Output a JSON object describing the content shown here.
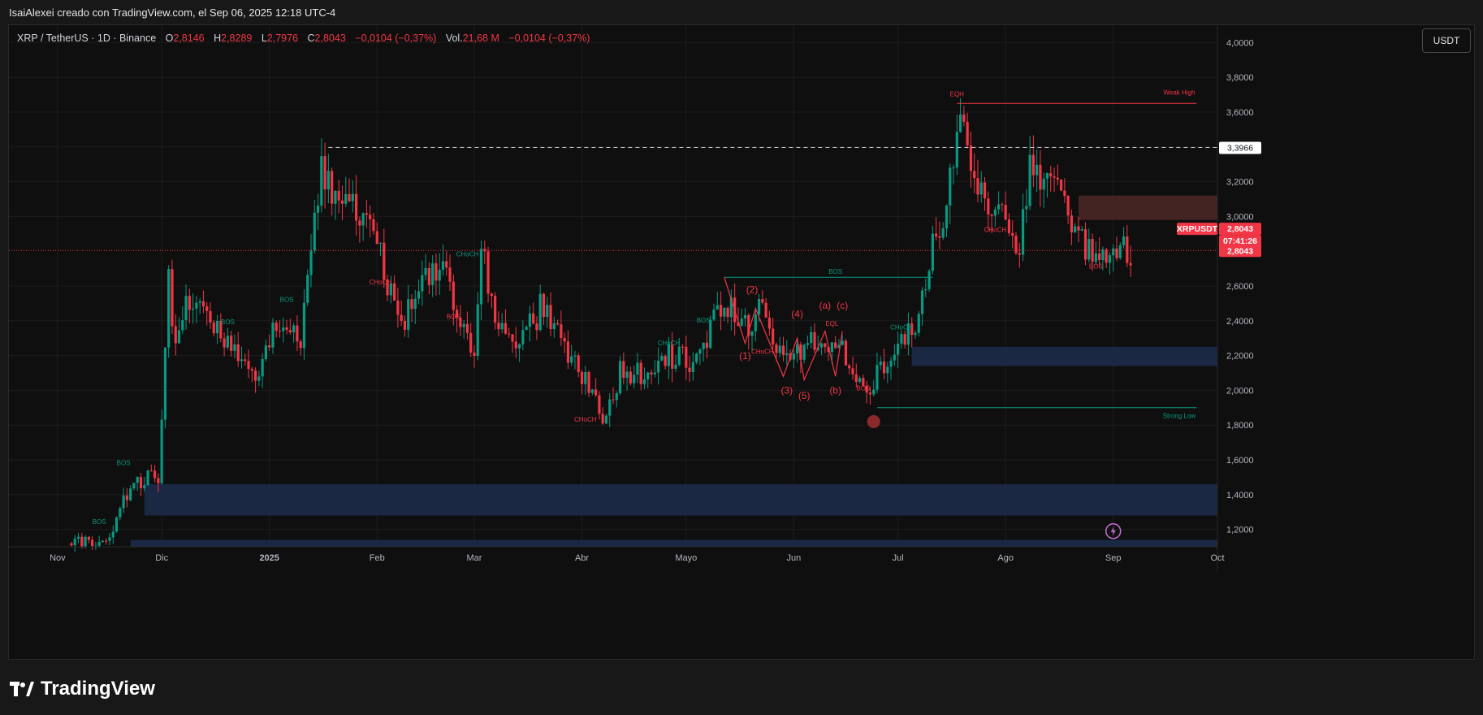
{
  "header": {
    "credit": "IsaiAlexei creado con TradingView.com, el Sep 06, 2025 12:18 UTC-4"
  },
  "legend": {
    "symbol": "XRP / TetherUS · 1D · Binance",
    "o_label": "O",
    "o": "2,8146",
    "h_label": "H",
    "h": "2,8289",
    "l_label": "L",
    "l": "2,7976",
    "c_label": "C",
    "c": "2,8043",
    "change": "−0,0104 (−0,37%)",
    "vol_label": "Vol.",
    "vol": "21,68 M",
    "vol_change": "−0,0104 (−0,37%)"
  },
  "currency_button": "USDT",
  "footer": {
    "brand": "TradingView"
  },
  "chart_data": {
    "type": "candlestick",
    "symbol": "XRPUSDT",
    "exchange": "Binance",
    "interval": "1D",
    "x_range": [
      "2024-10-18",
      "2025-10-01"
    ],
    "y_range": [
      1.1,
      4.1
    ],
    "y_ticks": [
      "4,0000",
      "3,8000",
      "3,6000",
      "3,4000",
      "3,2000",
      "3,0000",
      "2,6000",
      "2,4000",
      "2,2000",
      "2,0000",
      "1,8000",
      "1,6000",
      "1,4000",
      "1,2000"
    ],
    "y_tick_values": [
      4.0,
      3.8,
      3.6,
      3.4,
      3.2,
      3.0,
      2.6,
      2.4,
      2.2,
      2.0,
      1.8,
      1.6,
      1.4,
      1.2
    ],
    "x_ticks": [
      {
        "label": "Nov",
        "date": "2024-11-01"
      },
      {
        "label": "Dic",
        "date": "2024-12-01"
      },
      {
        "label": "2025",
        "date": "2025-01-01"
      },
      {
        "label": "Feb",
        "date": "2025-02-01"
      },
      {
        "label": "Mar",
        "date": "2025-03-01"
      },
      {
        "label": "Abr",
        "date": "2025-04-01"
      },
      {
        "label": "Mayo",
        "date": "2025-05-01"
      },
      {
        "label": "Jun",
        "date": "2025-06-01"
      },
      {
        "label": "Jul",
        "date": "2025-07-01"
      },
      {
        "label": "Ago",
        "date": "2025-08-01"
      },
      {
        "label": "Sep",
        "date": "2025-09-01"
      },
      {
        "label": "Oct",
        "date": "2025-10-01"
      }
    ],
    "grid": true,
    "colors": {
      "up": "#089981",
      "down": "#f23645",
      "zone_blue": "#1c2b4a",
      "zone_red": "#4a2626"
    },
    "price_path": [
      {
        "date": "2024-11-05",
        "close": 1.12
      },
      {
        "date": "2024-11-15",
        "close": 1.13
      },
      {
        "date": "2024-11-22",
        "close": 1.45
      },
      {
        "date": "2024-11-30",
        "close": 1.52
      },
      {
        "date": "2024-12-03",
        "close": 2.62
      },
      {
        "date": "2024-12-05",
        "close": 2.25
      },
      {
        "date": "2024-12-09",
        "close": 2.55
      },
      {
        "date": "2024-12-15",
        "close": 2.35
      },
      {
        "date": "2024-12-22",
        "close": 2.25
      },
      {
        "date": "2024-12-29",
        "close": 2.05
      },
      {
        "date": "2025-01-03",
        "close": 2.4
      },
      {
        "date": "2025-01-10",
        "close": 2.3
      },
      {
        "date": "2025-01-16",
        "close": 3.3
      },
      {
        "date": "2025-01-20",
        "close": 3.05
      },
      {
        "date": "2025-01-27",
        "close": 3.05
      },
      {
        "date": "2025-02-02",
        "close": 2.75
      },
      {
        "date": "2025-02-08",
        "close": 2.4
      },
      {
        "date": "2025-02-14",
        "close": 2.6
      },
      {
        "date": "2025-02-20",
        "close": 2.7
      },
      {
        "date": "2025-02-25",
        "close": 2.35
      },
      {
        "date": "2025-03-01",
        "close": 2.15
      },
      {
        "date": "2025-03-03",
        "close": 2.85
      },
      {
        "date": "2025-03-07",
        "close": 2.35
      },
      {
        "date": "2025-03-15",
        "close": 2.3
      },
      {
        "date": "2025-03-21",
        "close": 2.5
      },
      {
        "date": "2025-03-30",
        "close": 2.15
      },
      {
        "date": "2025-04-07",
        "close": 1.85
      },
      {
        "date": "2025-04-12",
        "close": 2.1
      },
      {
        "date": "2025-04-20",
        "close": 2.08
      },
      {
        "date": "2025-04-26",
        "close": 2.2
      },
      {
        "date": "2025-05-04",
        "close": 2.15
      },
      {
        "date": "2025-05-12",
        "close": 2.55
      },
      {
        "date": "2025-05-17",
        "close": 2.35
      },
      {
        "date": "2025-05-22",
        "close": 2.45
      },
      {
        "date": "2025-05-30",
        "close": 2.2
      },
      {
        "date": "2025-06-05",
        "close": 2.25
      },
      {
        "date": "2025-06-10",
        "close": 2.3
      },
      {
        "date": "2025-06-17",
        "close": 2.2
      },
      {
        "date": "2025-06-22",
        "close": 2.0
      },
      {
        "date": "2025-06-27",
        "close": 2.15
      },
      {
        "date": "2025-07-02",
        "close": 2.25
      },
      {
        "date": "2025-07-07",
        "close": 2.4
      },
      {
        "date": "2025-07-11",
        "close": 2.85
      },
      {
        "date": "2025-07-14",
        "close": 3.0
      },
      {
        "date": "2025-07-18",
        "close": 3.5
      },
      {
        "date": "2025-07-21",
        "close": 3.45
      },
      {
        "date": "2025-07-26",
        "close": 3.05
      },
      {
        "date": "2025-08-02",
        "close": 2.95
      },
      {
        "date": "2025-08-05",
        "close": 2.85
      },
      {
        "date": "2025-08-08",
        "close": 3.3
      },
      {
        "date": "2025-08-14",
        "close": 3.15
      },
      {
        "date": "2025-08-19",
        "close": 3.05
      },
      {
        "date": "2025-08-24",
        "close": 2.85
      },
      {
        "date": "2025-08-30",
        "close": 2.8
      },
      {
        "date": "2025-09-06",
        "close": 2.8
      }
    ],
    "hlines": [
      {
        "id": "swing-high-dashed",
        "value": 3.3966,
        "from": "2025-01-18",
        "to": "2025-10-01",
        "style": "dashed",
        "color": "#c8c8c8"
      },
      {
        "id": "weak-high",
        "value": 3.65,
        "from": "2025-07-18",
        "to": "2025-09-25",
        "style": "solid",
        "color": "#f23645"
      },
      {
        "id": "strong-low",
        "value": 1.9,
        "from": "2025-06-25",
        "to": "2025-09-25",
        "style": "solid",
        "color": "#089981"
      },
      {
        "id": "bos-jul",
        "value": 2.65,
        "from": "2025-05-12",
        "to": "2025-07-11",
        "style": "solid",
        "color": "#089981"
      },
      {
        "id": "current-price",
        "value": 2.8043,
        "from": "2024-10-18",
        "to": "2025-10-01",
        "style": "dotted",
        "color": "#f23645"
      }
    ],
    "zones": [
      {
        "id": "demand-low",
        "y1": 1.28,
        "y2": 1.46,
        "from": "2024-11-26",
        "to": "2025-10-01",
        "color": "#1c2b4a"
      },
      {
        "id": "demand-bottom",
        "y1": 1.1,
        "y2": 1.14,
        "from": "2024-11-22",
        "to": "2025-10-01",
        "color": "#1c2b4a"
      },
      {
        "id": "demand-jul",
        "y1": 2.14,
        "y2": 2.25,
        "from": "2025-07-05",
        "to": "2025-10-01",
        "color": "#1c2b4a"
      },
      {
        "id": "supply-aug",
        "y1": 2.98,
        "y2": 3.12,
        "from": "2025-08-22",
        "to": "2025-10-01",
        "color": "#4a2626"
      }
    ],
    "structure_labels": [
      {
        "text": "BOS",
        "date": "2024-11-20",
        "value": 1.57,
        "color": "#089981"
      },
      {
        "text": "BOS",
        "date": "2024-11-13",
        "value": 1.23,
        "color": "#089981"
      },
      {
        "text": "BOS",
        "date": "2024-12-20",
        "value": 2.38,
        "color": "#089981"
      },
      {
        "text": "BOS",
        "date": "2025-01-06",
        "value": 2.51,
        "color": "#089981"
      },
      {
        "text": "CHoCH",
        "date": "2025-02-02",
        "value": 2.61,
        "color": "#f23645"
      },
      {
        "text": "CHoCH",
        "date": "2025-02-27",
        "value": 2.77,
        "color": "#089981"
      },
      {
        "text": "BOS",
        "date": "2025-02-23",
        "value": 2.41,
        "color": "#f23645"
      },
      {
        "text": "CHoCH",
        "date": "2025-04-02",
        "value": 1.82,
        "color": "#f23645"
      },
      {
        "text": "CHoCH",
        "date": "2025-04-26",
        "value": 2.26,
        "color": "#089981"
      },
      {
        "text": "BOS",
        "date": "2025-05-06",
        "value": 2.39,
        "color": "#089981"
      },
      {
        "text": "BOS",
        "date": "2025-06-13",
        "value": 2.67,
        "color": "#089981"
      },
      {
        "text": "CHoCH",
        "date": "2025-05-23",
        "value": 2.21,
        "color": "#f23645"
      },
      {
        "text": "EQL",
        "date": "2025-06-12",
        "value": 2.37,
        "color": "#f23645"
      },
      {
        "text": "BOS",
        "date": "2025-06-21",
        "value": 2.0,
        "color": "#f23645"
      },
      {
        "text": "CHoCH",
        "date": "2025-07-02",
        "value": 2.35,
        "color": "#089981"
      },
      {
        "text": "EQH",
        "date": "2025-07-18",
        "value": 3.69,
        "color": "#f23645"
      },
      {
        "text": "CHoCH",
        "date": "2025-07-29",
        "value": 2.91,
        "color": "#f23645"
      },
      {
        "text": "BOS",
        "date": "2025-08-27",
        "value": 2.7,
        "color": "#f23645"
      },
      {
        "text": "Weak High",
        "date": "2025-09-20",
        "value": 3.7,
        "color": "#f23645"
      },
      {
        "text": "Strong Low",
        "date": "2025-09-20",
        "value": 1.84,
        "color": "#089981"
      }
    ],
    "wave_labels": [
      {
        "text": "(1)",
        "date": "2025-05-18",
        "value": 2.18
      },
      {
        "text": "(2)",
        "date": "2025-05-20",
        "value": 2.56
      },
      {
        "text": "(3)",
        "date": "2025-05-30",
        "value": 1.98
      },
      {
        "text": "(4)",
        "date": "2025-06-02",
        "value": 2.42
      },
      {
        "text": "(5)",
        "date": "2025-06-04",
        "value": 1.95
      },
      {
        "text": "(a)",
        "date": "2025-06-10",
        "value": 2.47
      },
      {
        "text": "(b)",
        "date": "2025-06-13",
        "value": 1.98
      },
      {
        "text": "(c)",
        "date": "2025-06-15",
        "value": 2.47
      }
    ],
    "wave_path": [
      {
        "date": "2025-05-12",
        "value": 2.65
      },
      {
        "date": "2025-05-18",
        "value": 2.27
      },
      {
        "date": "2025-05-21",
        "value": 2.47
      },
      {
        "date": "2025-05-29",
        "value": 2.08
      },
      {
        "date": "2025-06-02",
        "value": 2.3
      },
      {
        "date": "2025-06-04",
        "value": 2.06
      },
      {
        "date": "2025-06-10",
        "value": 2.34
      },
      {
        "date": "2025-06-13",
        "value": 2.08
      },
      {
        "date": "2025-06-15",
        "value": 2.34
      }
    ],
    "price_tags": [
      {
        "text": "3,3966",
        "value": 3.3966,
        "style": "light"
      },
      {
        "text": "XRPUSDT",
        "value": 2.9,
        "style": "red-left"
      },
      {
        "text": "2,8043",
        "value": 2.9,
        "style": "red"
      },
      {
        "text": "07:41:26",
        "value": 2.84,
        "style": "red"
      },
      {
        "text": "2,8043",
        "value": 2.8043,
        "style": "red"
      }
    ],
    "markers": [
      {
        "type": "circle",
        "date": "2025-06-24",
        "value": 1.82,
        "color": "#8b2a2a"
      },
      {
        "type": "lightning",
        "date": "2025-09-01",
        "value": 1.19,
        "color": "#c770d9"
      }
    ]
  }
}
